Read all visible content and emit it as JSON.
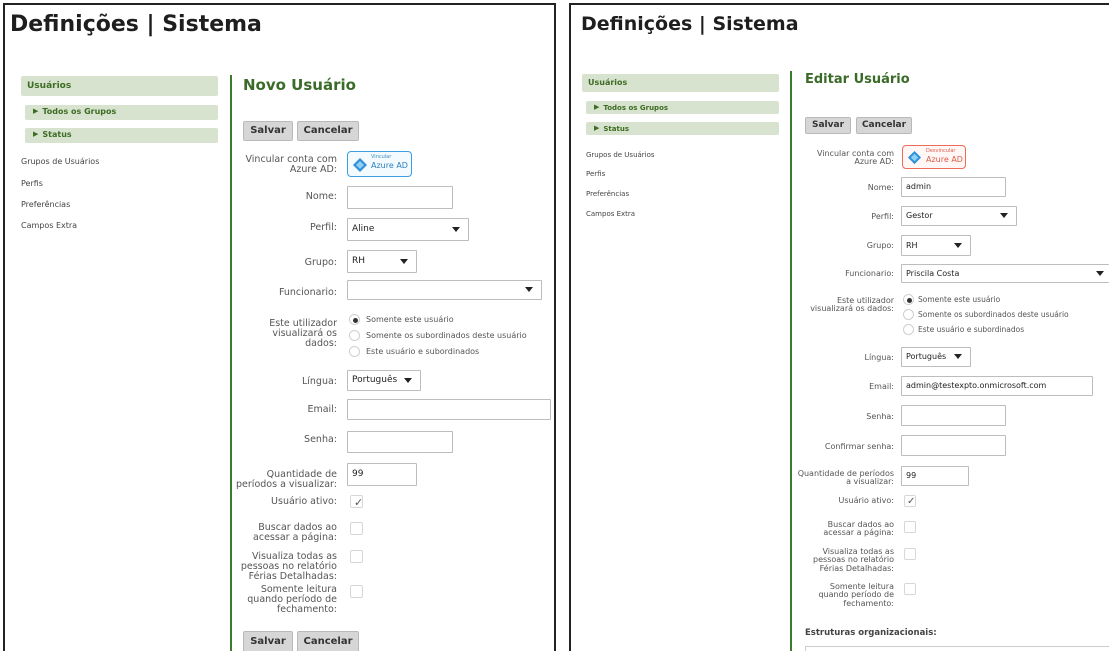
{
  "left": {
    "title": "Definições | Sistema",
    "sidebar": {
      "head": "Usuários",
      "subs": [
        "Todos os Grupos",
        "Status"
      ],
      "links": [
        "Grupos de Usuários",
        "Perfis",
        "Preferências",
        "Campos Extra"
      ]
    },
    "form": {
      "title": "Novo Usuário",
      "save": "Salvar",
      "cancel": "Cancelar",
      "azure_label": "Vincular conta com Azure AD:",
      "azure_small": "Vincular",
      "azure_big": "Azure AD",
      "name_label": "Nome:",
      "name_value": "",
      "profile_label": "Perfil:",
      "profile_value": "Aline",
      "group_label": "Grupo:",
      "group_value": "RH",
      "employee_label": "Funcionario:",
      "employee_value": "",
      "view_label": "Este utilizador visualizará os dados:",
      "view_options": [
        "Somente este usuário",
        "Somente os subordinados deste usuário",
        "Este usuário e subordinados"
      ],
      "language_label": "Língua:",
      "language_value": "Português",
      "email_label": "Email:",
      "email_value": "",
      "password_label": "Senha:",
      "password_value": "",
      "periods_label": "Quantidade de períodos a visualizar:",
      "periods_value": "99",
      "active_label": "Usuário ativo:",
      "fetch_label": "Buscar dados ao acessar a página:",
      "vacation_label": "Visualiza todas as pessoas no relatório Férias Detalhadas:",
      "readonly_label": "Somente leitura quando período de fechamento:"
    }
  },
  "right": {
    "title": "Definições | Sistema",
    "sidebar": {
      "head": "Usuários",
      "subs": [
        "Todos os Grupos",
        "Status"
      ],
      "links": [
        "Grupos de Usuários",
        "Perfis",
        "Preferências",
        "Campos Extra"
      ]
    },
    "form": {
      "title": "Editar Usuário",
      "save": "Salvar",
      "cancel": "Cancelar",
      "azure_label": "Vincular conta com Azure AD:",
      "azure_small": "Desvincular",
      "azure_big": "Azure AD",
      "name_label": "Nome:",
      "name_value": "admin",
      "profile_label": "Perfil:",
      "profile_value": "Gestor",
      "group_label": "Grupo:",
      "group_value": "RH",
      "employee_label": "Funcionario:",
      "employee_value": "Priscila Costa",
      "view_label": "Este utilizador visualizará os dados:",
      "view_options": [
        "Somente este usuário",
        "Somente os subordinados deste usuário",
        "Este usuário e subordinados"
      ],
      "language_label": "Língua:",
      "language_value": "Português",
      "email_label": "Email:",
      "email_value": "admin@testexpto.onmicrosoft.com",
      "password_label": "Senha:",
      "confirm_label": "Confirmar senha:",
      "periods_label": "Quantidade de períodos a visualizar:",
      "periods_value": "99",
      "active_label": "Usuário ativo:",
      "fetch_label": "Buscar dados ao acessar a página:",
      "vacation_label": "Visualiza todas as pessoas no relatório Férias Detalhadas:",
      "readonly_label": "Somente leitura quando período de fechamento:",
      "org_label": "Estruturas organizacionais:"
    }
  },
  "colors": {
    "accent": "#3a7d2b",
    "sidebar_bg": "#d8e3cf",
    "azure_blue": "#3aa0e0",
    "azure_red": "#ef6b57"
  }
}
